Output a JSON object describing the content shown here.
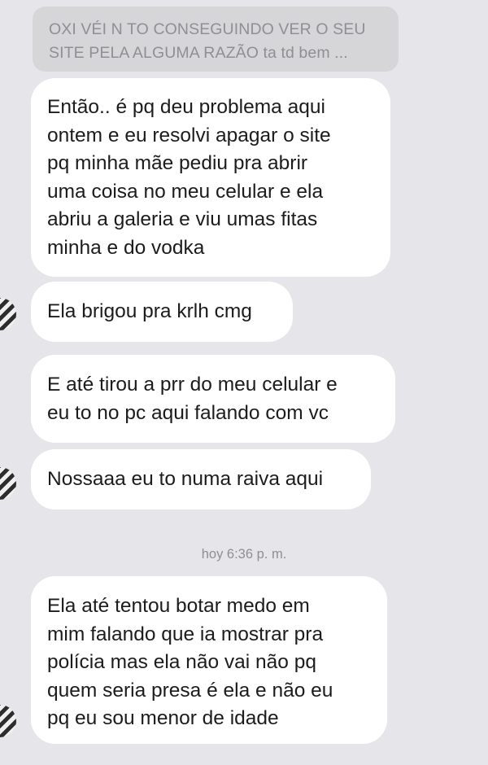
{
  "reply_quote": {
    "lines": [
      "OXI VÉI N TO CONSEGUINDO VER O SEU",
      "SITE PELA ALGUMA RAZÃO ta td bem ..."
    ]
  },
  "messages": [
    {
      "lines": [
        "Então.. é pq deu problema aqui",
        "ontem e eu resolvi apagar o site",
        "pq minha mãe pediu pra abrir",
        "uma coisa no meu celular e ela",
        "abriu a galeria e viu umas fitas",
        "minha e do vodka"
      ]
    },
    {
      "lines": [
        "Ela brigou pra krlh cmg"
      ]
    },
    {
      "lines": [
        "E até tirou a prr do meu celular e",
        "eu to no pc aqui falando com vc"
      ]
    },
    {
      "lines": [
        "Nossaaa eu to numa raiva aqui"
      ]
    },
    {
      "lines": [
        "Ela até tentou botar medo em",
        "mim falando que ia mostrar pra",
        "polícia mas ela não vai não pq",
        "quem seria presa é ela e não eu",
        "pq eu sou menor de idade"
      ]
    }
  ],
  "timestamp": "hoy 6:36 p. m."
}
